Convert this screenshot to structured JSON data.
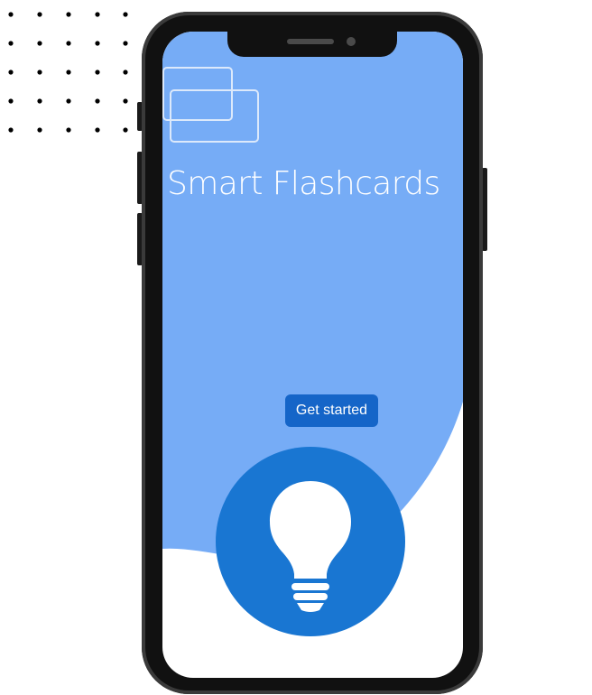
{
  "app": {
    "title": "Smart Flashcards",
    "cta_label": "Get started"
  },
  "icons": {
    "logo": "flashcards-icon",
    "hero": "lightbulb-icon"
  },
  "colors": {
    "primary_light": "#76acf6",
    "primary": "#1976d2",
    "button": "#1565c8",
    "text_on_primary": "#ffffff",
    "phone_frame": "#111111",
    "dot_pattern": "#000000"
  }
}
